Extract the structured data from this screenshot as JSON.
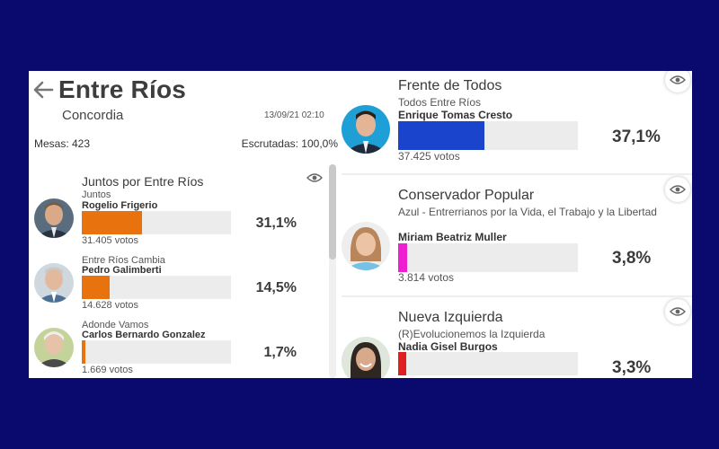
{
  "header": {
    "title": "Entre Ríos",
    "subtitle": "Concordia",
    "datetime": "13/09/21 02:10",
    "mesas": "Mesas: 423",
    "escrutadas": "Escrutadas: 100,0%"
  },
  "left_list": [
    {
      "party": "Juntos por Entre Ríos",
      "list": "Juntos",
      "candidate": "Rogelio Frigerio",
      "percent_label": "31,1%",
      "percent": 31.1,
      "votes": "31.405 votos",
      "color": "#e8730e"
    },
    {
      "party": "",
      "list": "Entre Ríos Cambia",
      "candidate": "Pedro Galimberti",
      "percent_label": "14,5%",
      "percent": 14.5,
      "votes": "14.628 votos",
      "color": "#e8730e"
    },
    {
      "party": "",
      "list": "Adonde Vamos",
      "candidate": "Carlos Bernardo Gonzalez",
      "percent_label": "1,7%",
      "percent": 1.7,
      "votes": "1.669 votos",
      "color": "#e8730e"
    }
  ],
  "right_list": [
    {
      "party": "Frente de Todos",
      "list": "Todos Entre Ríos",
      "candidate": "Enrique Tomas Cresto",
      "percent_label": "37,1%",
      "percent": 37.1,
      "votes": "37.425 votos",
      "color": "#1a44cc"
    },
    {
      "party": "Conservador Popular",
      "list": "Azul - Entrerrianos por la Vida, el Trabajo y la Libertad",
      "candidate": "Miriam Beatriz Muller",
      "percent_label": "3,8%",
      "percent": 3.8,
      "votes": "3.814 votos",
      "color": "#ee1fd1"
    },
    {
      "party": "Nueva Izquierda",
      "list": "(R)Evolucionemos la Izquierda",
      "candidate": "Nadia Gisel Burgos",
      "percent_label": "3,3%",
      "percent": 3.3,
      "votes": "",
      "color": "#e02020"
    }
  ],
  "icons": {
    "back": "arrow-left-icon",
    "eye": "eye-icon"
  }
}
